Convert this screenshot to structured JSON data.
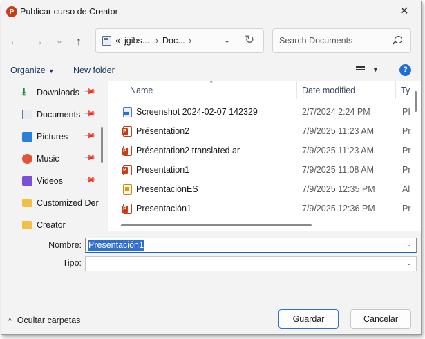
{
  "window": {
    "title": "Publicar curso de Creator",
    "app_icon_letter": "P",
    "close_glyph": "✕"
  },
  "nav": {
    "back_glyph": "←",
    "forward_glyph": "→",
    "history_glyph": "⌄",
    "up_glyph": "↑"
  },
  "address": {
    "overflow": "«",
    "segments": [
      "jgibs...",
      "Doc..."
    ],
    "separator": "›",
    "dropdown_glyph": "⌄",
    "refresh_glyph": "↻"
  },
  "search": {
    "placeholder": "Search Documents"
  },
  "toolbar": {
    "organize_label": "Organize",
    "organize_caret": "▼",
    "new_folder_label": "New folder",
    "view_caret": "▼",
    "help_glyph": "?"
  },
  "sidebar": {
    "pin_glyph": "📌",
    "items": [
      {
        "label": "Downloads",
        "icon": "download-icon",
        "pinned": true
      },
      {
        "label": "Documents",
        "icon": "document-icon",
        "pinned": true
      },
      {
        "label": "Pictures",
        "icon": "pictures-icon",
        "pinned": true
      },
      {
        "label": "Music",
        "icon": "music-icon",
        "pinned": true
      },
      {
        "label": "Videos",
        "icon": "videos-icon",
        "pinned": true
      },
      {
        "label": "Customized Der",
        "icon": "folder-icon",
        "pinned": false
      },
      {
        "label": "Creator",
        "icon": "folder-icon",
        "pinned": false
      }
    ]
  },
  "files": {
    "columns": [
      "Name",
      "Date modified",
      "Ty"
    ],
    "sort_glyph": "⌃",
    "rows": [
      {
        "name": "Screenshot 2024-02-07 142329",
        "date": "2/7/2024 2:24 PM",
        "type": "PI",
        "icon": "image-file-icon"
      },
      {
        "name": "Présentation2",
        "date": "7/9/2025 11:23 AM",
        "type": "Pr",
        "icon": "powerpoint-file-icon"
      },
      {
        "name": "Présentation2 translated ar",
        "date": "7/9/2025 11:23 AM",
        "type": "Pr",
        "icon": "powerpoint-file-icon"
      },
      {
        "name": "Presentation1",
        "date": "7/9/2025 11:08 AM",
        "type": "Pr",
        "icon": "powerpoint-file-icon"
      },
      {
        "name": "PresentaciónES",
        "date": "7/9/2025 12:35 PM",
        "type": "Al",
        "icon": "slideshow-file-icon"
      },
      {
        "name": "Presentación1",
        "date": "7/9/2025 12:36 PM",
        "type": "Pr",
        "icon": "powerpoint-file-icon"
      }
    ]
  },
  "form": {
    "name_label": "Nombre:",
    "name_value": "Presentación1",
    "type_label": "Tipo:",
    "type_value": "",
    "dropdown_glyph": "⌄"
  },
  "footer": {
    "hide_folders_caret": "^",
    "hide_folders_label": "Ocultar carpetas",
    "save_label": "Guardar",
    "cancel_label": "Cancelar"
  },
  "colors": {
    "accent": "#2f6fd0",
    "powerpoint": "#c43e1c",
    "dialog_bg": "#f3f3f3"
  }
}
